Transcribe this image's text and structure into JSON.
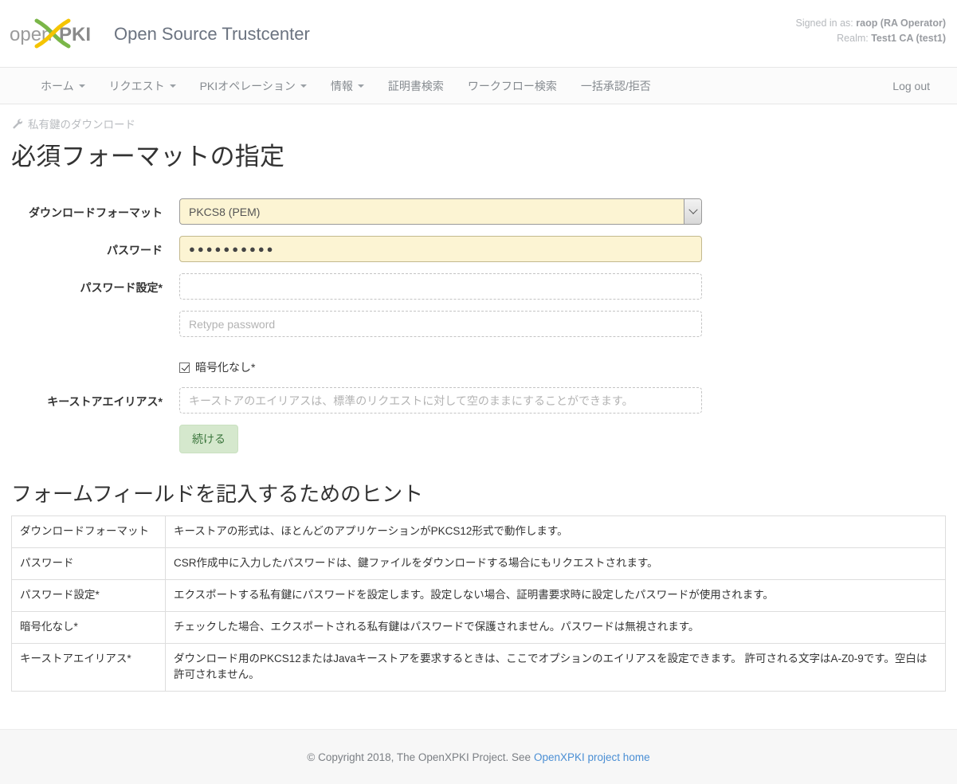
{
  "header": {
    "logo_text_left": "open",
    "logo_text_right": "PKI",
    "app_title": "Open Source Trustcenter",
    "signed_in_label": "Signed in as:",
    "signed_in_user": "raop (RA Operator)",
    "realm_label": "Realm:",
    "realm_value": "Test1 CA (test1)"
  },
  "nav": {
    "items": [
      {
        "label": "ホーム",
        "has_caret": true
      },
      {
        "label": "リクエスト",
        "has_caret": true
      },
      {
        "label": "PKIオペレーション",
        "has_caret": true
      },
      {
        "label": "情報",
        "has_caret": true
      },
      {
        "label": "証明書検索",
        "has_caret": false
      },
      {
        "label": "ワークフロー検索",
        "has_caret": false
      },
      {
        "label": "一括承認/拒否",
        "has_caret": false
      }
    ],
    "logout_label": "Log out"
  },
  "page": {
    "breadcrumb_icon": "wrench-icon",
    "breadcrumb": "私有鍵のダウンロード",
    "title": "必須フォーマットの指定"
  },
  "form": {
    "download_format": {
      "label": "ダウンロードフォーマット",
      "value": "PKCS8 (PEM)"
    },
    "password": {
      "label": "パスワード",
      "value": "●●●●●●●●●●"
    },
    "password_set": {
      "label": "パスワード設定*",
      "value": "",
      "placeholder": ""
    },
    "password_retype": {
      "value": "",
      "placeholder": "Retype password"
    },
    "no_encryption": {
      "label": "暗号化なし*",
      "checked": true
    },
    "keystore_alias": {
      "label": "キーストアエイリアス*",
      "value": "",
      "placeholder": "キーストアのエイリアスは、標準のリクエストに対して空のままにすることができます。"
    },
    "submit_label": "続ける"
  },
  "hints": {
    "title": "フォームフィールドを記入するためのヒント",
    "rows": [
      {
        "key": "ダウンロードフォーマット",
        "value": "キーストアの形式は、ほとんどのアプリケーションがPKCS12形式で動作します。"
      },
      {
        "key": "パスワード",
        "value": "CSR作成中に入力したパスワードは、鍵ファイルをダウンロードする場合にもリクエストされます。"
      },
      {
        "key": "パスワード設定*",
        "value": "エクスポートする私有鍵にパスワードを設定します。設定しない場合、証明書要求時に設定したパスワードが使用されます。"
      },
      {
        "key": "暗号化なし*",
        "value": "チェックした場合、エクスポートされる私有鍵はパスワードで保護されません。パスワードは無視されます。"
      },
      {
        "key": "キーストアエイリアス*",
        "value": "ダウンロード用のPKCS12またはJavaキーストアを要求するときは、ここでオプションのエイリアスを設定できます。 許可される文字はA-Z0-9です。空白は許可されません。"
      }
    ]
  },
  "footer": {
    "copyright": "© Copyright 2018, The OpenXPKI Project. See",
    "link_label": "OpenXPKI project home"
  },
  "colors": {
    "accent_link": "#4b8fd4",
    "input_filled_bg": "#fcf4d3",
    "button_bg": "#d5e8cd",
    "button_text": "#3c763d",
    "logo_green": "#7ab648",
    "logo_yellow": "#f5c400",
    "logo_gray": "#9b9b9b"
  }
}
